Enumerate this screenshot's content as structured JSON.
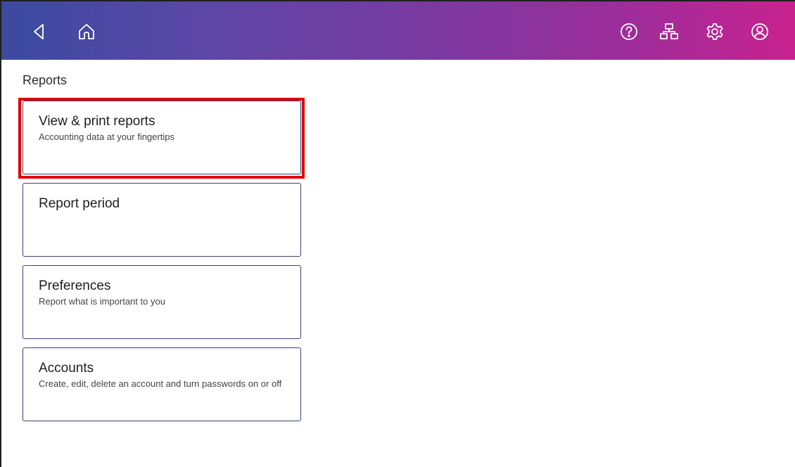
{
  "topbar": {
    "icons": [
      "back-icon",
      "home-icon",
      "help-icon",
      "network-icon",
      "settings-icon",
      "account-icon"
    ],
    "gradient_start": "#3b4aa0",
    "gradient_end": "#c8228f"
  },
  "page": {
    "title": "Reports"
  },
  "cards": [
    {
      "title": "View & print reports",
      "subtitle": "Accounting data at your fingertips",
      "highlighted": true
    },
    {
      "title": "Report period",
      "subtitle": ""
    },
    {
      "title": "Preferences",
      "subtitle": "Report what is important to you"
    },
    {
      "title": "Accounts",
      "subtitle": "Create, edit, delete an account and turn passwords on or off"
    }
  ],
  "colors": {
    "highlight": "#e00000",
    "card_border": "#3a3f7a"
  }
}
